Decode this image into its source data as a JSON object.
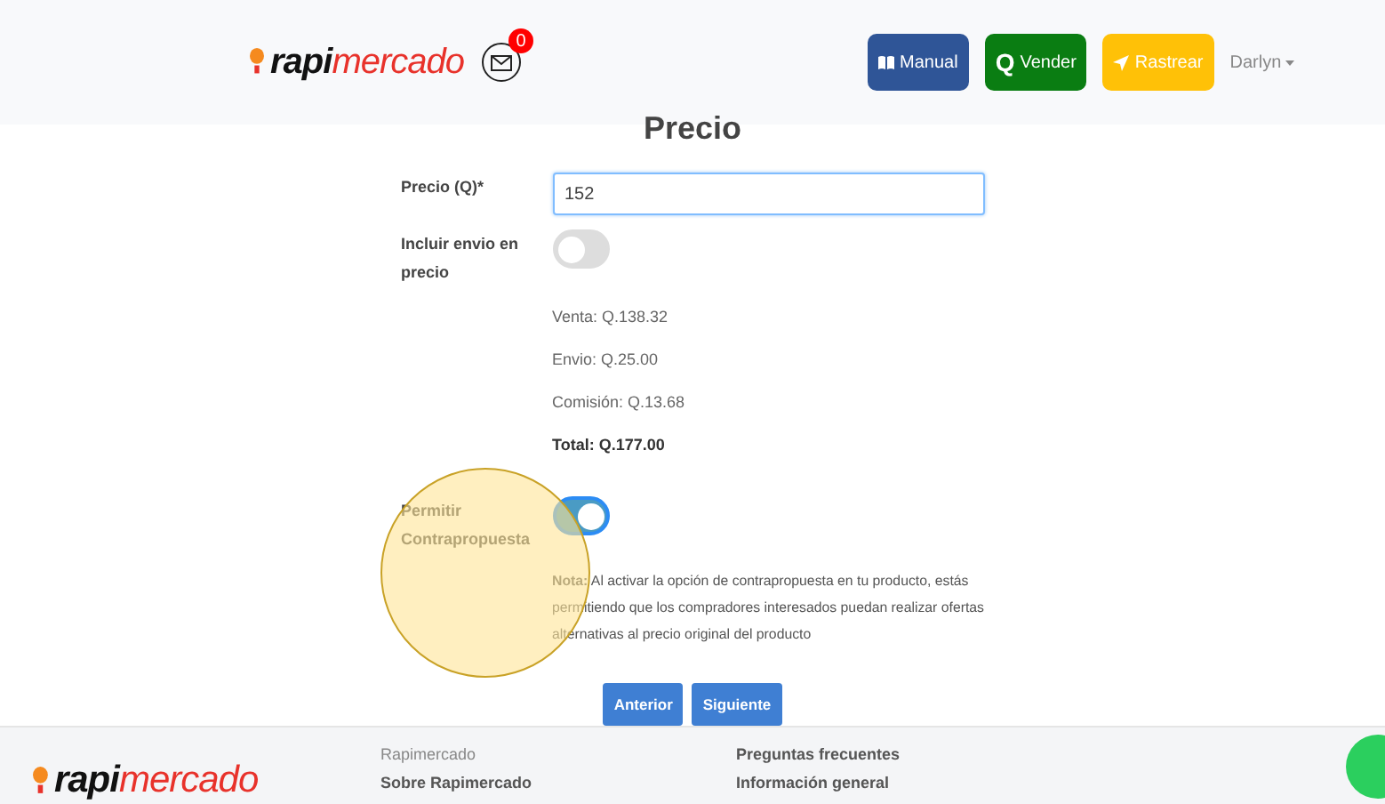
{
  "header": {
    "logo": {
      "lead": "rapi",
      "rest": "mercado"
    },
    "notifications": "0",
    "buttons": [
      {
        "kind": "manual",
        "label": "Manual"
      },
      {
        "kind": "vender",
        "glyph": "Q",
        "label": "Vender"
      },
      {
        "kind": "rastrear",
        "label": "Rastrear"
      }
    ],
    "user": "Darlyn"
  },
  "title": "Precio",
  "price_field": {
    "label": "Precio (Q)*",
    "value": "152"
  },
  "include_shipping": {
    "label": "Incluir envio en precio",
    "on": false
  },
  "summary": [
    {
      "text": "Venta: Q.138.32",
      "bold": false
    },
    {
      "text": "Envio: Q.25.00",
      "bold": false
    },
    {
      "text": "Comisión: Q.13.68",
      "bold": false
    },
    {
      "text": "Total: Q.177.00",
      "bold": true
    }
  ],
  "counteroffer": {
    "label": "Permitir Contrapropuesta",
    "on": true,
    "note": "**Nota:** Al activar la opción de contrapropuesta en tu producto, estás permitiendo que los compradores interesados puedan realizar ofertas alternativas al precio original del producto"
  },
  "nav_buttons": [
    "Anterior",
    "Siguiente"
  ],
  "footer": {
    "logo": {
      "lead": "rapi",
      "rest": "mercado"
    },
    "columns": [
      [
        {
          "text": "Rapimercado",
          "kind": "heading"
        },
        {
          "text": "Sobre Rapimercado",
          "kind": "link"
        }
      ],
      [
        {
          "text": "Preguntas frecuentes",
          "kind": "link"
        },
        {
          "text": "Información general",
          "kind": "link"
        }
      ]
    ]
  }
}
